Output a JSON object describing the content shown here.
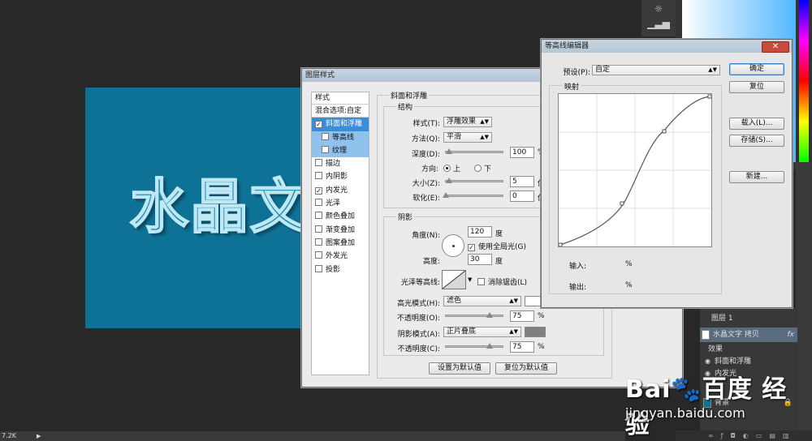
{
  "canvas": {
    "text": "水晶文字",
    "bg_color": "#0e7296"
  },
  "status": {
    "zoom": "7.2K"
  },
  "layer_style": {
    "title": "图层样式",
    "styles_header": "样式",
    "blend_options": "混合选项:自定",
    "items": [
      {
        "label": "斜面和浮雕",
        "checked": "✓"
      },
      {
        "label": "等高线",
        "checked": ""
      },
      {
        "label": "纹理",
        "checked": ""
      },
      {
        "label": "描边",
        "checked": ""
      },
      {
        "label": "内阴影",
        "checked": ""
      },
      {
        "label": "内发光",
        "checked": "✓"
      },
      {
        "label": "光泽",
        "checked": ""
      },
      {
        "label": "颜色叠加",
        "checked": ""
      },
      {
        "label": "渐变叠加",
        "checked": ""
      },
      {
        "label": "图案叠加",
        "checked": ""
      },
      {
        "label": "外发光",
        "checked": ""
      },
      {
        "label": "投影",
        "checked": ""
      }
    ],
    "panel_title": "斜面和浮雕",
    "structure": {
      "title": "结构",
      "style_label": "样式(T):",
      "style_value": "浮雕效果",
      "method_label": "方法(Q):",
      "method_value": "平滑",
      "depth_label": "深度(D):",
      "depth_value": "100",
      "depth_unit": "%",
      "direction_label": "方向:",
      "dir_up": "上",
      "dir_down": "下",
      "size_label": "大小(Z):",
      "size_value": "5",
      "size_unit": "像",
      "soften_label": "软化(E):",
      "soften_value": "0",
      "soften_unit": "像"
    },
    "shading": {
      "title": "阴影",
      "angle_label": "角度(N):",
      "angle_value": "120",
      "angle_unit": "度",
      "global_light_label": "使用全局光(G)",
      "global_light_checked": "✓",
      "altitude_label": "高度:",
      "altitude_value": "30",
      "altitude_unit": "度",
      "gloss_contour_label": "光泽等高线:",
      "antialias_label": "消除锯齿(L)",
      "highlight_mode_label": "高光模式(H):",
      "highlight_mode_value": "滤色",
      "highlight_opacity_label": "不透明度(O):",
      "highlight_opacity_value": "75",
      "highlight_opacity_unit": "%",
      "shadow_mode_label": "阴影模式(A):",
      "shadow_mode_value": "正片叠底",
      "shadow_opacity_label": "不透明度(C):",
      "shadow_opacity_value": "75",
      "shadow_opacity_unit": "%",
      "highlight_color": "#ffffff",
      "shadow_color": "#808080"
    },
    "set_default": "设置为默认值",
    "reset_default": "复位为默认值"
  },
  "contour_editor": {
    "title": "等高线编辑器",
    "preset_label": "预设(P):",
    "preset_value": "自定",
    "mapping_label": "映射",
    "input_label": "输入:",
    "input_unit": "%",
    "output_label": "输出:",
    "output_unit": "%",
    "ok": "确定",
    "reset": "复位",
    "load": "载入(L)...",
    "save": "存储(S)...",
    "new": "新建..."
  },
  "layers": {
    "group_name": "图层 1",
    "text_layer": "水晶文字 拷贝",
    "effects_label": "效果",
    "effect_1": "斜面和浮雕",
    "effect_2": "内发光",
    "bg_layer": "背景",
    "fx": "fx"
  },
  "watermark": {
    "logo": "Bai🐾百度 经验",
    "url": "jingyan.baidu.com"
  }
}
